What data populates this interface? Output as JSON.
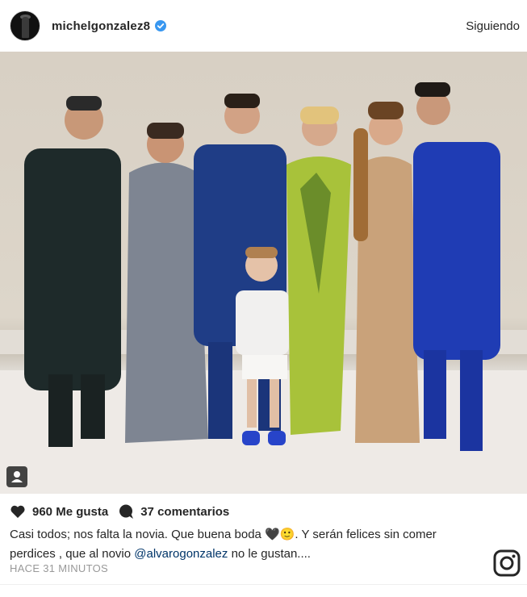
{
  "post": {
    "username": "michelgonzalez8",
    "follow_state": "Siguiendo",
    "likes": "960 Me gusta",
    "comments": "37 comentarios",
    "caption_part1": "Casi todos; nos falta la novia. Que buena boda ",
    "caption_emojis": "🖤🙂",
    "caption_part2": ". Y serán felices sin comer perdices , que al novio ",
    "mention": "@alvarogonzalez",
    "caption_part3": " no le gustan....",
    "timestamp": "HACE 31 MINUTOS"
  },
  "icons": {
    "verified": "verified-badge-icon",
    "like": "heart-icon",
    "comment": "comment-bubble-icon",
    "tag": "user-tag-icon",
    "brand": "instagram-logo-icon"
  },
  "colors": {
    "verified_blue": "#3897f0",
    "mention_blue": "#003569",
    "timestamp_gray": "#999999"
  }
}
